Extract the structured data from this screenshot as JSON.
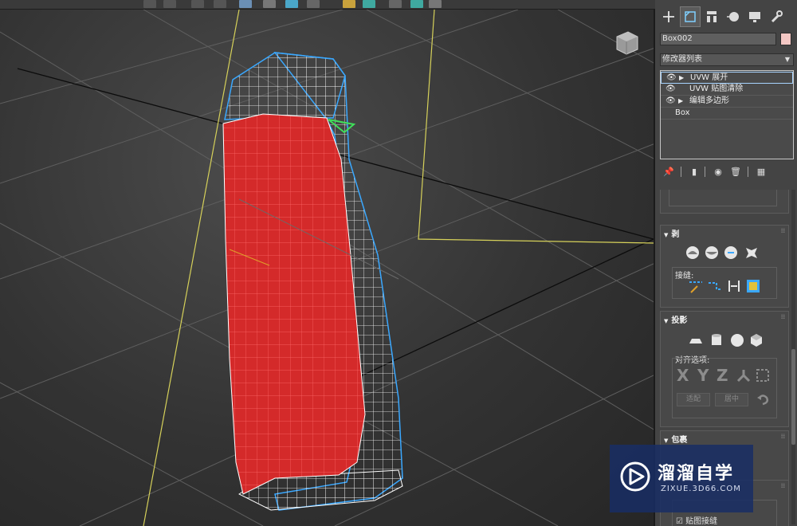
{
  "object": {
    "name": "Box002",
    "color": "#f3c7c4"
  },
  "command_tabs": [
    {
      "id": "create",
      "icon": "plus-icon"
    },
    {
      "id": "modify",
      "icon": "modify-icon"
    },
    {
      "id": "hierarchy",
      "icon": "hierarchy-icon"
    },
    {
      "id": "motion",
      "icon": "motion-icon"
    },
    {
      "id": "display",
      "icon": "display-icon"
    },
    {
      "id": "utilities",
      "icon": "wrench-icon"
    }
  ],
  "modifier_list": {
    "label": "修改器列表"
  },
  "modifier_stack": [
    {
      "label": "UVW 展开",
      "has_eye": true,
      "expandable": true,
      "selected": true
    },
    {
      "label": "UVW 贴图清除",
      "has_eye": true,
      "expandable": false,
      "selected": false
    },
    {
      "label": "编辑多边形",
      "has_eye": true,
      "expandable": true,
      "selected": false
    },
    {
      "label": "Box",
      "has_eye": false,
      "expandable": false,
      "selected": false
    }
  ],
  "rollouts": {
    "peel": {
      "title": "剥",
      "seams_label": "接缝:"
    },
    "projection": {
      "title": "投影",
      "align_label": "对齐选项:",
      "axis_letters": [
        "X",
        "Y",
        "Z"
      ],
      "fit_button": "适配",
      "center_button": "居中"
    },
    "wrap": {
      "title": "包裹"
    },
    "map_seams_checkbox": "贴图接缝"
  },
  "watermark": {
    "title": "溜溜自学",
    "subtitle": "ZIXUE.3D66.COM"
  },
  "colors": {
    "selected_faces": "#d42a2a",
    "wire": "#ffffff",
    "seam": "#3aa8ff",
    "plane": "#d6d15a",
    "panel_bg": "#444444"
  }
}
